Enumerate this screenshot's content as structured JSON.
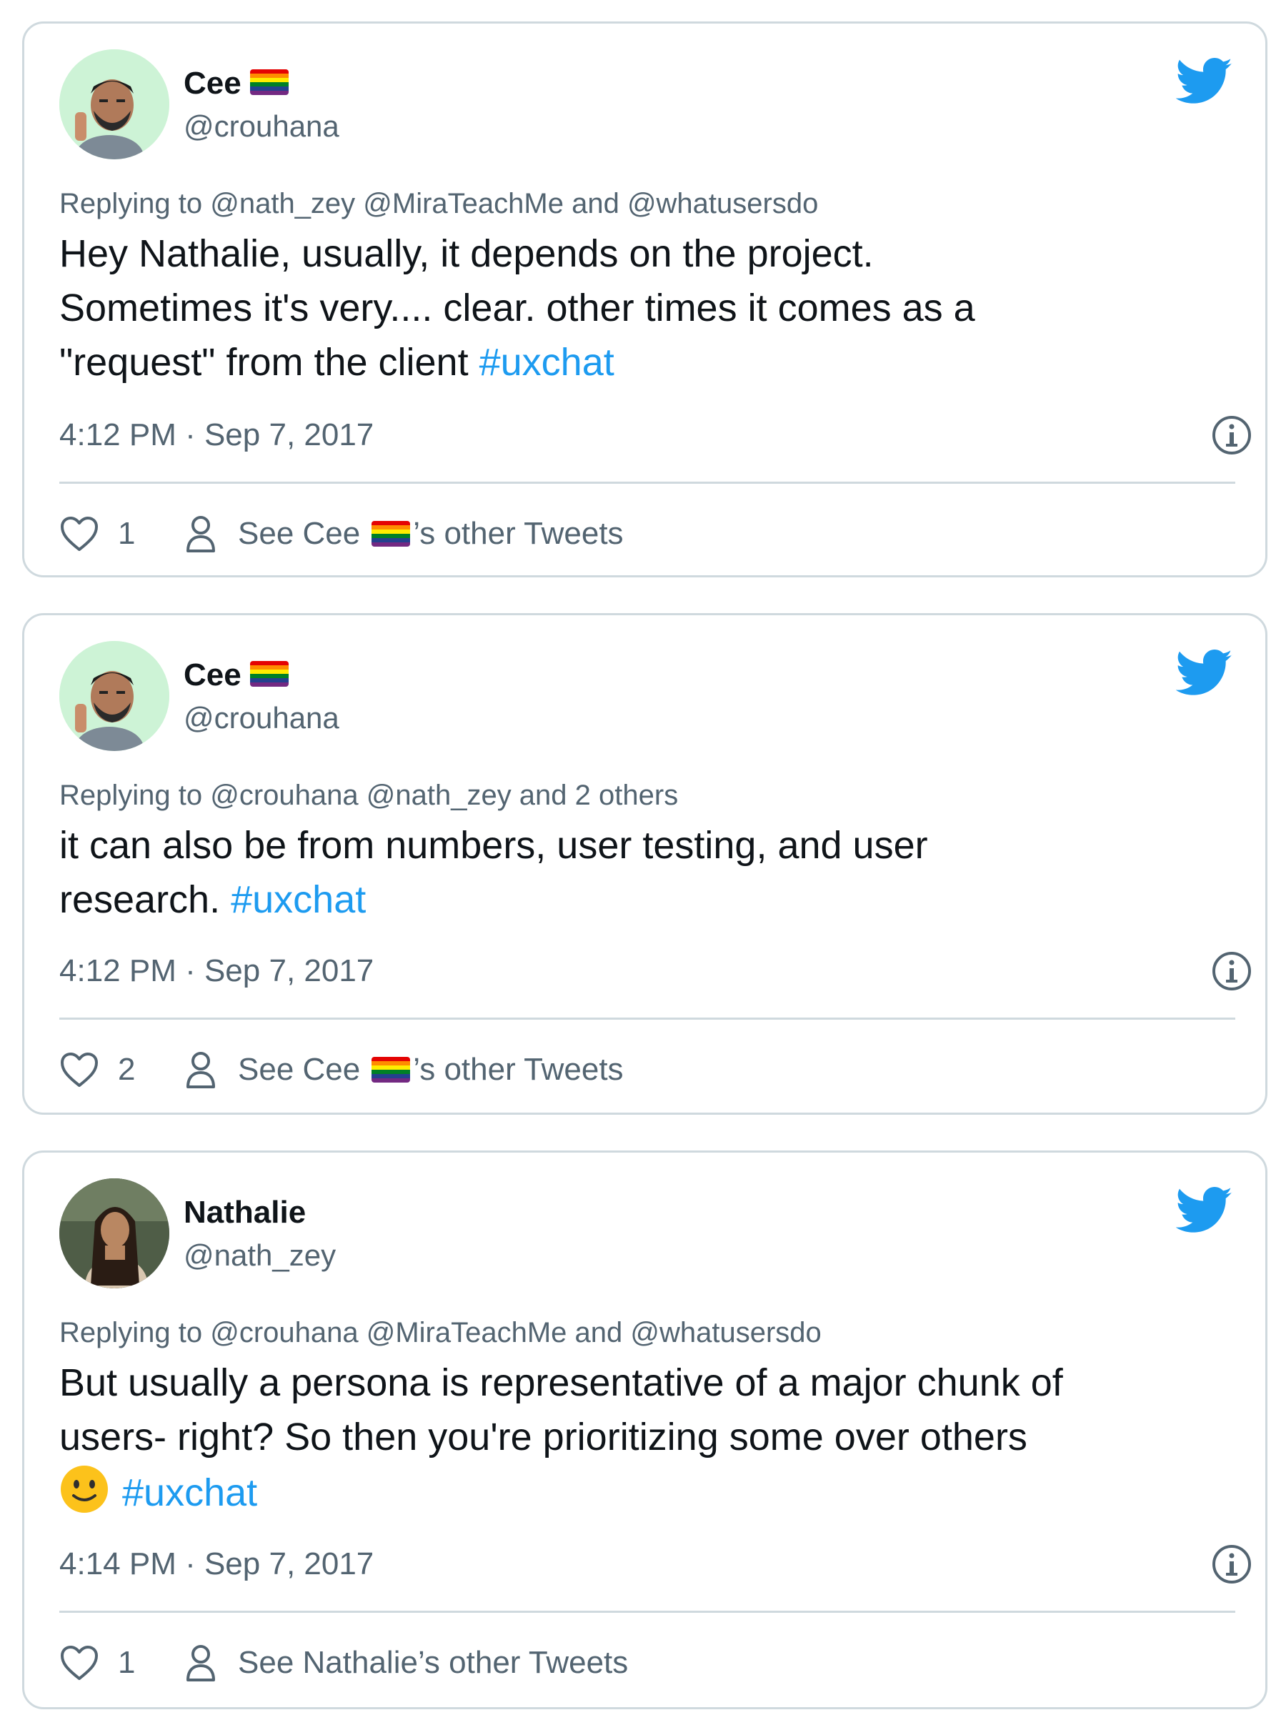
{
  "tweets": [
    {
      "author": {
        "name": "Cee",
        "handle": "@crouhana",
        "flag": "rainbow-flag"
      },
      "replying_to": "Replying to @nath_zey @MiraTeachMe and @whatusersdo",
      "text": "Hey Nathalie, usually, it depends on the project.\nSometimes it's very.... clear. other times it comes as a\n\"request\" from the client ",
      "hashtag": "#uxchat",
      "timestamp": "4:12 PM · Sep 7, 2017",
      "likes": "1",
      "other_tweets_prefix": "See Cee ",
      "other_tweets_suffix": "’s other Tweets"
    },
    {
      "author": {
        "name": "Cee",
        "handle": "@crouhana",
        "flag": "rainbow-flag"
      },
      "replying_to": "Replying to @crouhana @nath_zey and 2 others",
      "text": "it can also be from numbers, user testing, and user\nresearch. ",
      "hashtag": "#uxchat",
      "timestamp": "4:12 PM · Sep 7, 2017",
      "likes": "2",
      "other_tweets_prefix": "See Cee ",
      "other_tweets_suffix": "’s other Tweets"
    },
    {
      "author": {
        "name": "Nathalie",
        "handle": "@nath_zey"
      },
      "replying_to": "Replying to @crouhana @MiraTeachMe and @whatusersdo",
      "text": "But usually a persona is representative of a major chunk of\nusers- right? So then you're prioritizing some over others\n",
      "emoji": "slightly-smiling-face",
      "hashtag": "#uxchat",
      "timestamp": "4:14 PM · Sep 7, 2017",
      "likes": "1",
      "other_tweets_prefix": "See Nathalie’s other Tweets",
      "other_tweets_suffix": ""
    }
  ],
  "colors": {
    "twitter_blue": "#1d9bf0",
    "secondary_text": "#536471",
    "border": "#cfd9de",
    "avatar_bg": "#c9f2d3"
  },
  "icons": [
    "twitter-bird-icon",
    "info-icon",
    "heart-icon",
    "person-icon",
    "rainbow-flag-icon",
    "smiling-face-emoji"
  ]
}
